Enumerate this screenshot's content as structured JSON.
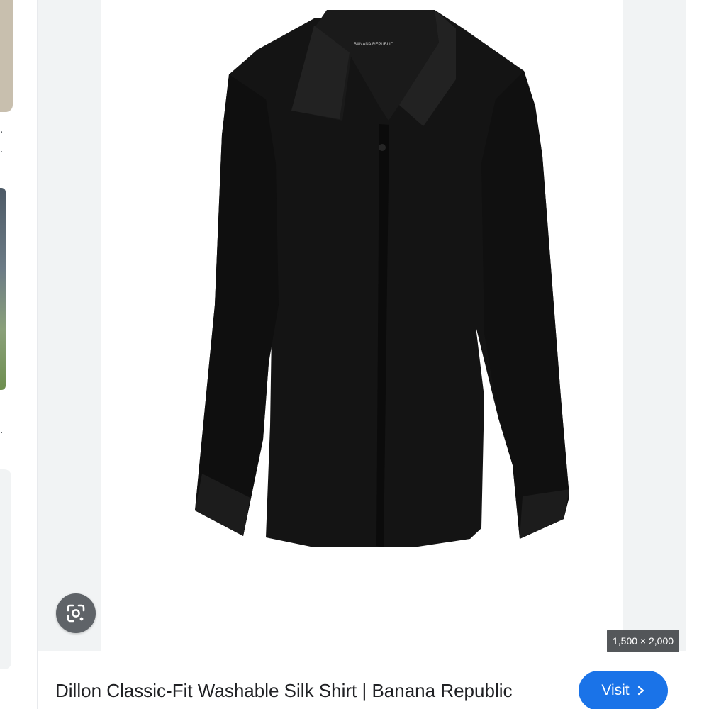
{
  "result": {
    "title": "Dillon Classic-Fit Washable Silk Shirt | Banana Republic",
    "dimensions": "1,500 × 2,000",
    "visit_label": "Visit",
    "brand_label": "BANANA REPUBLIC"
  },
  "icons": {
    "lens": "google-lens-icon",
    "visit": "chevron-right-icon"
  },
  "colors": {
    "accent": "#1a73e8",
    "shirt": "#141414",
    "lens_button": "#5f6368"
  }
}
